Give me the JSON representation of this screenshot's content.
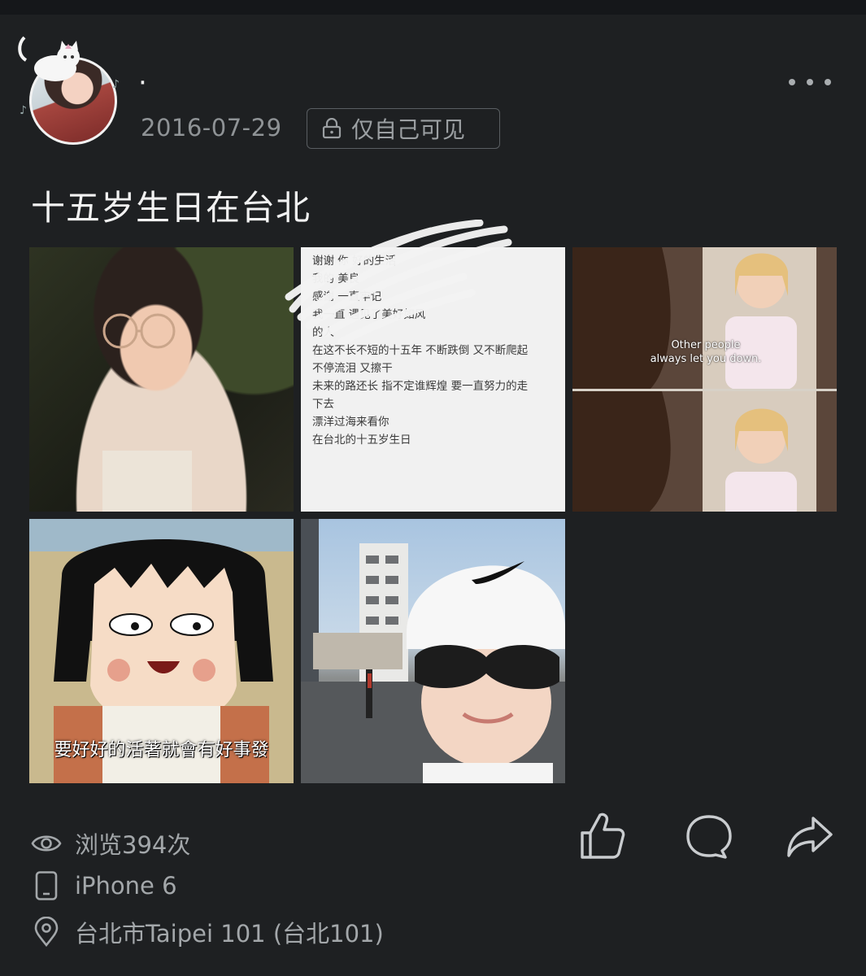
{
  "post": {
    "username": "·",
    "date": "2016-07-29",
    "privacy_label": "仅自己可见",
    "text": "十五岁生日在台北"
  },
  "photos": {
    "note_lines": [
      "谢谢   你                     好的生活",
      "我的                          美良",
      "                              ",
      "感谢                          一直牢记",
      "我一直                         遇见了美好如风",
      "的人",
      "在这不长不短的十五年 不断跌倒 又不断爬起",
      "不停流泪 又擦干",
      "未来的路还长 指不定谁辉煌 要一直努力的走",
      "下去",
      "漂洋过海来看你",
      "在台北的十五岁生日"
    ],
    "movie_subtitle_1": "Other people",
    "movie_subtitle_2": "always let you down.",
    "cartoon_caption": "要好好的活著就會有好事發"
  },
  "footer": {
    "views": "浏览394次",
    "device": "iPhone 6",
    "location": "台北市Taipei 101 (台北101)"
  },
  "icons": {
    "more": "more-dots-icon",
    "lock": "lock-icon",
    "eye": "eye-icon",
    "phone": "phone-icon",
    "location": "location-pin-icon",
    "like": "thumbs-up-icon",
    "comment": "comment-bubble-icon",
    "share": "share-arrow-icon"
  },
  "colors": {
    "background": "#1e2022",
    "muted_text": "#a3a7aa",
    "primary_text": "#f2f2f2"
  }
}
